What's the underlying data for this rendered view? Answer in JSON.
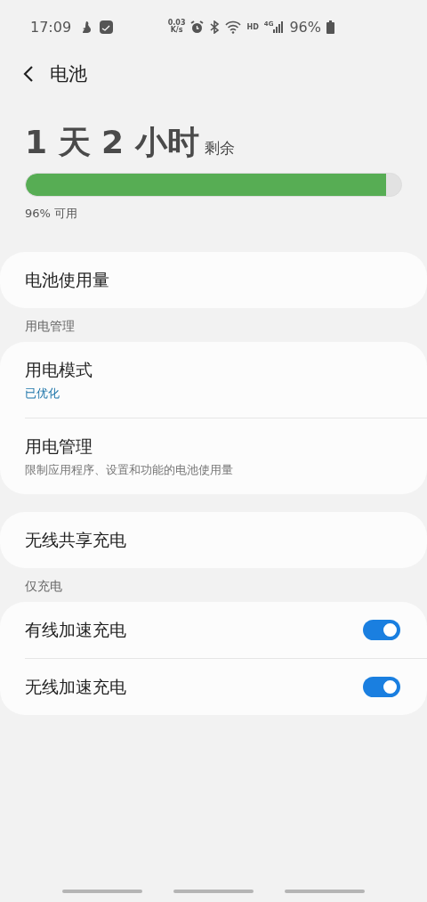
{
  "status_bar": {
    "time": "17:09",
    "net_speed_value": "0.03",
    "net_speed_unit": "K/s",
    "hd": "HD",
    "network": "4G",
    "battery": "96%"
  },
  "header": {
    "title": "电池"
  },
  "battery": {
    "remaining": "1 天 2 小时",
    "remaining_label": "剩余",
    "level": 0.96,
    "available": "96% 可用"
  },
  "sections": [
    {
      "kind": "card",
      "items": [
        {
          "title": "电池使用量"
        }
      ]
    },
    {
      "kind": "header",
      "title": "用电管理"
    },
    {
      "kind": "card",
      "items": [
        {
          "title": "用电模式",
          "subtitle": "已优化",
          "accent": true
        },
        {
          "title": "用电管理",
          "subtitle": "限制应用程序、设置和功能的电池使用量",
          "accent": false
        }
      ]
    },
    {
      "kind": "card",
      "items": [
        {
          "title": "无线共享充电"
        }
      ]
    },
    {
      "kind": "header",
      "title": "仅充电"
    },
    {
      "kind": "card",
      "items": [
        {
          "title": "有线加速充电",
          "on": true
        },
        {
          "title": "无线加速充电",
          "on": true
        }
      ]
    }
  ]
}
